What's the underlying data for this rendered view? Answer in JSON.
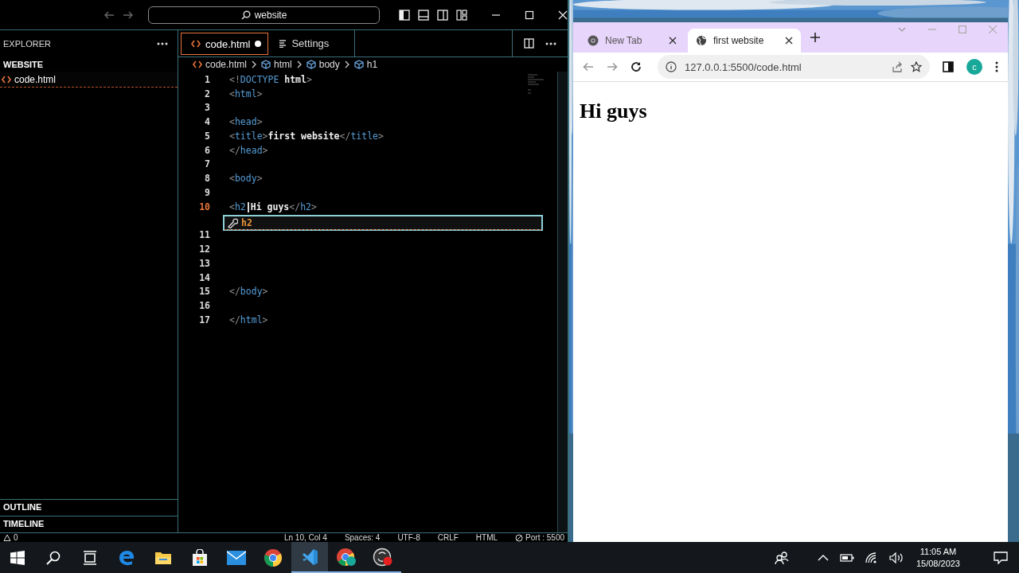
{
  "editor": {
    "search": "website",
    "sidebar_title": "EXPLORER",
    "folder": "WEBSITE",
    "files": [
      {
        "name": "code.html",
        "selected": true
      }
    ],
    "tabs": [
      {
        "label": "code.html",
        "kind": "html",
        "selected": true,
        "modified": true
      },
      {
        "label": "Settings",
        "kind": "settings",
        "selected": false,
        "modified": false
      }
    ],
    "breadcrumbs": [
      {
        "label": "code.html",
        "kind": "html"
      },
      {
        "label": "html",
        "kind": "element"
      },
      {
        "label": "body",
        "kind": "element"
      },
      {
        "label": "h1",
        "kind": "element"
      }
    ],
    "lines": [
      {
        "number": "1",
        "active": false,
        "tokens": [
          {
            "kind": "punct",
            "text": "<!"
          },
          {
            "kind": "tag",
            "text": "DOCTYPE"
          },
          {
            "kind": "text",
            "text": " html"
          },
          {
            "kind": "punct",
            "text": ">"
          }
        ]
      },
      {
        "number": "2",
        "active": false,
        "tokens": [
          {
            "kind": "punct",
            "text": "<"
          },
          {
            "kind": "tag",
            "text": "html"
          },
          {
            "kind": "punct",
            "text": ">"
          }
        ]
      },
      {
        "number": "3",
        "active": false
      },
      {
        "number": "4",
        "active": false,
        "tokens": [
          {
            "kind": "punct",
            "text": "<"
          },
          {
            "kind": "tag",
            "text": "head"
          },
          {
            "kind": "punct",
            "text": ">"
          }
        ]
      },
      {
        "number": "5",
        "active": false,
        "tokens": [
          {
            "kind": "punct",
            "text": "<"
          },
          {
            "kind": "tag",
            "text": "title"
          },
          {
            "kind": "punct",
            "text": ">"
          },
          {
            "kind": "text",
            "text": "first website"
          },
          {
            "kind": "punct",
            "text": "</"
          },
          {
            "kind": "tag",
            "text": "title"
          },
          {
            "kind": "punct",
            "text": ">"
          }
        ]
      },
      {
        "number": "6",
        "active": false,
        "tokens": [
          {
            "kind": "punct",
            "text": "</"
          },
          {
            "kind": "tag",
            "text": "head"
          },
          {
            "kind": "punct",
            "text": ">"
          }
        ]
      },
      {
        "number": "7",
        "active": false
      },
      {
        "number": "8",
        "active": false,
        "tokens": [
          {
            "kind": "punct",
            "text": "<"
          },
          {
            "kind": "tag",
            "text": "body"
          },
          {
            "kind": "punct",
            "text": ">"
          }
        ]
      },
      {
        "number": "9",
        "active": false
      },
      {
        "number": "10",
        "active": true,
        "tokens": [
          {
            "kind": "punct",
            "text": "<"
          },
          {
            "kind": "tag",
            "text": "h2"
          },
          {
            "kind": "cursor"
          },
          {
            "kind": "text",
            "text": "Hi guys"
          },
          {
            "kind": "punct",
            "text": "</"
          },
          {
            "kind": "tag",
            "text": "h2"
          },
          {
            "kind": "punct",
            "text": ">"
          }
        ],
        "suggestion": {
          "label": "h2"
        }
      },
      {
        "number": "11",
        "active": false
      },
      {
        "number": "12",
        "active": false
      },
      {
        "number": "13",
        "active": false
      },
      {
        "number": "14",
        "active": false
      },
      {
        "number": "15",
        "active": false,
        "tokens": [
          {
            "kind": "punct",
            "text": "</"
          },
          {
            "kind": "tag",
            "text": "body"
          },
          {
            "kind": "punct",
            "text": ">"
          }
        ]
      },
      {
        "number": "16",
        "active": false
      },
      {
        "number": "17",
        "active": false,
        "tokens": [
          {
            "kind": "punct",
            "text": "</"
          },
          {
            "kind": "tag",
            "text": "html"
          },
          {
            "kind": "punct",
            "text": ">"
          }
        ]
      }
    ],
    "panels": [
      "OUTLINE",
      "TIMELINE"
    ],
    "status": {
      "problems": "0",
      "items": [
        {
          "label": "Ln 10, Col 4",
          "kind": "text"
        },
        {
          "label": "Spaces: 4",
          "kind": "text"
        },
        {
          "label": "UTF-8",
          "kind": "text"
        },
        {
          "label": "CRLF",
          "kind": "text"
        },
        {
          "label": "HTML",
          "kind": "text"
        },
        {
          "label": "Port : 5500",
          "kind": "port"
        }
      ]
    }
  },
  "browser": {
    "tabs": [
      {
        "title": "New Tab",
        "kind": "chrome",
        "selected": false
      },
      {
        "title": "first website",
        "kind": "globe",
        "selected": true
      }
    ],
    "url": "127.0.0.1:5500/code.html",
    "profile": "c",
    "heading": "Hi guys"
  },
  "taskbar": {
    "apps": [
      {
        "kind": "search",
        "running": false,
        "selected": false
      },
      {
        "kind": "taskview",
        "running": false,
        "selected": false
      },
      {
        "kind": "edge",
        "running": false,
        "selected": false
      },
      {
        "kind": "folder",
        "running": false,
        "selected": false
      },
      {
        "kind": "store",
        "running": false,
        "selected": false
      },
      {
        "kind": "mail",
        "running": false,
        "selected": false
      },
      {
        "kind": "chrome",
        "running": false,
        "selected": false
      },
      {
        "kind": "vscode",
        "running": true,
        "selected": true
      },
      {
        "kind": "chrome-profile",
        "running": true,
        "selected": false
      },
      {
        "kind": "recorder",
        "running": true,
        "selected": false
      }
    ],
    "time": "11:05 AM",
    "date": "15/08/2023"
  }
}
